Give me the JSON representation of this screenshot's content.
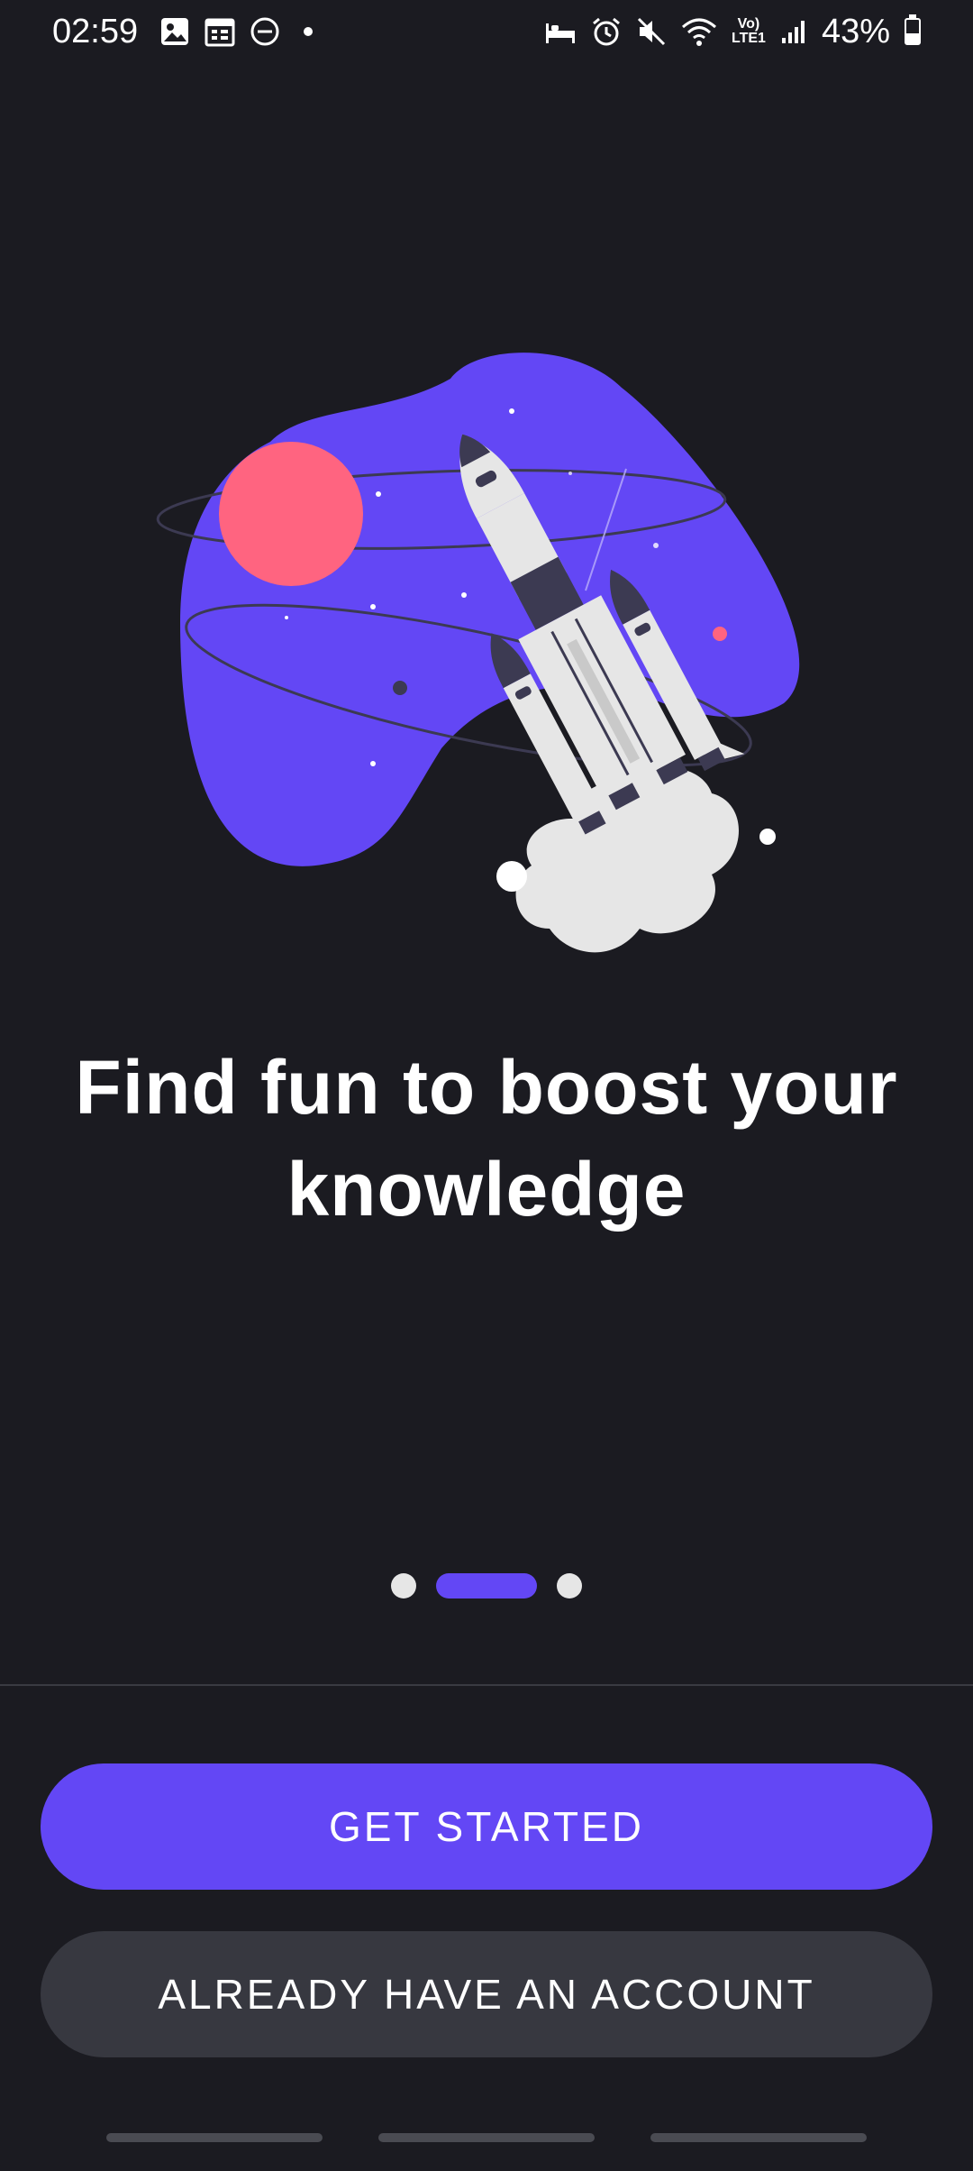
{
  "status_bar": {
    "time": "02:59",
    "battery": "43%",
    "network_label_top": "Vo)",
    "network_label_bottom": "LTE1",
    "icons": [
      "image-icon",
      "calendar-icon",
      "dnd-icon",
      "notification-dot",
      "sleep-icon",
      "alarm-icon",
      "mute-icon",
      "wifi-icon",
      "signal-icon",
      "battery-icon"
    ],
    "battery_level": 0.43
  },
  "onboarding": {
    "illustration": "rocket-launch-illustration",
    "headline": "Find fun to boost your knowledge",
    "pager": {
      "count": 3,
      "active_index": 1
    }
  },
  "actions": {
    "primary_label": "GET STARTED",
    "secondary_label": "ALREADY HAVE AN ACCOUNT"
  },
  "colors": {
    "background": "#1b1b21",
    "accent": "#6347f5",
    "planet": "#ff6480",
    "secondary_button": "#373840"
  }
}
